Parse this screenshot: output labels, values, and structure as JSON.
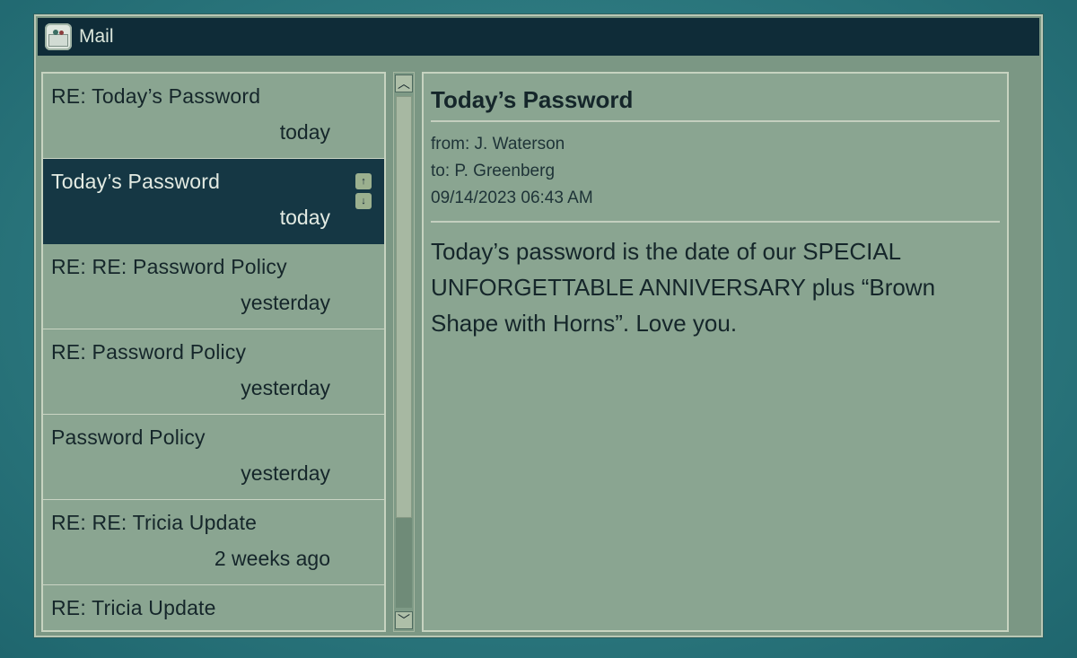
{
  "window": {
    "title": "Mail",
    "icon": "mail-envelope-icon"
  },
  "message_list": [
    {
      "subject": "RE: Today’s Password",
      "date": "today",
      "selected": false
    },
    {
      "subject": "Today’s Password",
      "date": "today",
      "selected": true
    },
    {
      "subject": "RE: RE: Password Policy",
      "date": "yesterday",
      "selected": false
    },
    {
      "subject": "RE: Password Policy",
      "date": "yesterday",
      "selected": false
    },
    {
      "subject": "Password Policy",
      "date": "yesterday",
      "selected": false
    },
    {
      "subject": "RE: RE: Tricia Update",
      "date": "2 weeks ago",
      "selected": false
    },
    {
      "subject": "RE: Tricia Update",
      "date": "",
      "selected": false
    }
  ],
  "selected_controls": {
    "up": "↑",
    "down": "↓"
  },
  "scroll": {
    "up": "︿",
    "down": "﹀"
  },
  "reader": {
    "subject": "Today’s Password",
    "from": "from: J. Waterson",
    "to": "to: P. Greenberg",
    "timestamp": "09/14/2023 06:43 AM",
    "body": "Today’s password is the date of our SPECIAL UNFORGETTABLE ANNIVERSARY plus “Brown Shape with Horns”. Love you."
  },
  "colors": {
    "titlebar": "#0f2c38",
    "selected_row": "#153744",
    "panel": "#8aa591",
    "background": "#2f7c82"
  }
}
